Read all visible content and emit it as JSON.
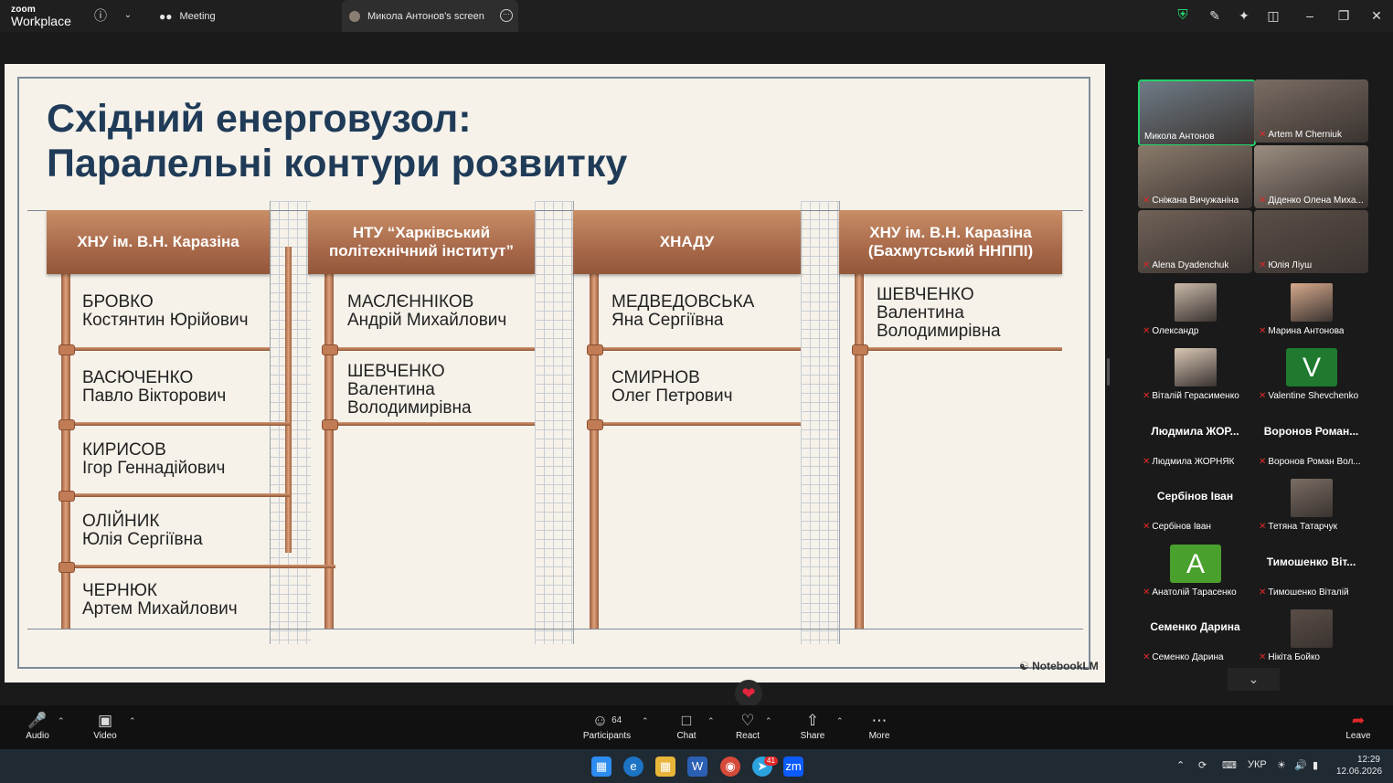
{
  "titlebar": {
    "logo_top": "zoom",
    "logo_bottom": "Workplace",
    "tabs": [
      {
        "label": "Meeting"
      },
      {
        "label": "Микола Антонов's screen"
      }
    ]
  },
  "slide": {
    "title_line1": "Східний енерговузол:",
    "title_line2": "Паралельні контури розвитку",
    "watermark": "NotebookLM",
    "columns": [
      {
        "header_line1": "ХНУ ім. В.Н. Каразіна",
        "header_line2": "",
        "people": [
          {
            "surname": "БРОВКО",
            "given": "Костянтин Юрійович"
          },
          {
            "surname": "ВАСЮЧЕНКО",
            "given": "Павло Вікторович"
          },
          {
            "surname": "КИРИСОВ",
            "given": "Ігор Геннадійович"
          },
          {
            "surname": "ОЛІЙНИК",
            "given": "Юлія Сергіївна"
          },
          {
            "surname": "ЧЕРНЮК",
            "given": "Артем Михайлович"
          }
        ]
      },
      {
        "header_line1": "НТУ “Харківський",
        "header_line2": "політехнічний інститут”",
        "people": [
          {
            "surname": "МАСЛЄННІКОВ",
            "given": "Андрій Михайлович"
          },
          {
            "surname": "ШЕВЧЕНКО",
            "given": "Валентина",
            "given2": "Володимирівна"
          }
        ]
      },
      {
        "header_line1": "ХНАДУ",
        "header_line2": "",
        "people": [
          {
            "surname": "МЕДВЕДОВСЬКА",
            "given": "Яна Сергіївна"
          },
          {
            "surname": "СМИРНОВ",
            "given": "Олег Петрович"
          }
        ]
      },
      {
        "header_line1": "ХНУ ім. В.Н. Каразіна",
        "header_line2": "(Бахмутський ННППІ)",
        "people": [
          {
            "surname": "ШЕВЧЕНКО",
            "given": "Валентина",
            "given2": "Володимирівна"
          }
        ]
      }
    ]
  },
  "gallery": {
    "participants": [
      {
        "label": "Микола Антонов",
        "muted": false,
        "kind": "video",
        "active": true
      },
      {
        "label": "Artem M Cherniuk",
        "muted": true,
        "kind": "video"
      },
      {
        "label": "Сніжана Вичужаніна",
        "muted": true,
        "kind": "video"
      },
      {
        "label": "Діденко Олена Миха...",
        "muted": true,
        "kind": "video"
      },
      {
        "label": "Alena Dyadenchuk",
        "muted": true,
        "kind": "video"
      },
      {
        "label": "Юлія Лiуш",
        "muted": true,
        "kind": "video"
      },
      {
        "label": "Олександр",
        "muted": true,
        "kind": "video"
      },
      {
        "label": "Марина Антонова",
        "muted": true,
        "kind": "video"
      },
      {
        "label": "Віталій Герасименко",
        "muted": true,
        "kind": "video"
      },
      {
        "label": "Valentine Shevchenko",
        "muted": true,
        "kind": "avatar",
        "avatar_letter": "V",
        "avatar_color": "#1f7a2f"
      },
      {
        "label": "Людмила ЖОРНЯК",
        "muted": true,
        "kind": "name",
        "big_name": "Людмила ЖОР..."
      },
      {
        "label": "Воронов Роман Вол...",
        "muted": true,
        "kind": "name",
        "big_name": "Воронов Роман..."
      },
      {
        "label": "Сербінов Іван",
        "muted": true,
        "kind": "name",
        "big_name": "Сербінов Іван"
      },
      {
        "label": "Тетяна Татарчук",
        "muted": true,
        "kind": "video"
      },
      {
        "label": "Анатолій Тарасенко",
        "muted": true,
        "kind": "avatar",
        "avatar_letter": "A",
        "avatar_color": "#4aa02c"
      },
      {
        "label": "Тимошенко Віталій",
        "muted": true,
        "kind": "name",
        "big_name": "Тимошенко Віт..."
      },
      {
        "label": "Семенко Дарина",
        "muted": true,
        "kind": "name",
        "big_name": "Семенко Дарина"
      },
      {
        "label": "Нікіта Бойко",
        "muted": true,
        "kind": "video"
      }
    ]
  },
  "toolbar": {
    "audio": "Audio",
    "video": "Video",
    "participants": "Participants",
    "participants_count": "64",
    "chat": "Chat",
    "react": "React",
    "share": "Share",
    "more": "More",
    "leave": "Leave"
  },
  "taskbar": {
    "lang": "УКР",
    "time": "12:29",
    "date": "12.06.2026",
    "telegram_badge": "41"
  },
  "colors": {
    "accent_green": "#23d26a",
    "copper": "#b0714f",
    "title_navy": "#1f3b57",
    "react_red": "#e5253c"
  }
}
